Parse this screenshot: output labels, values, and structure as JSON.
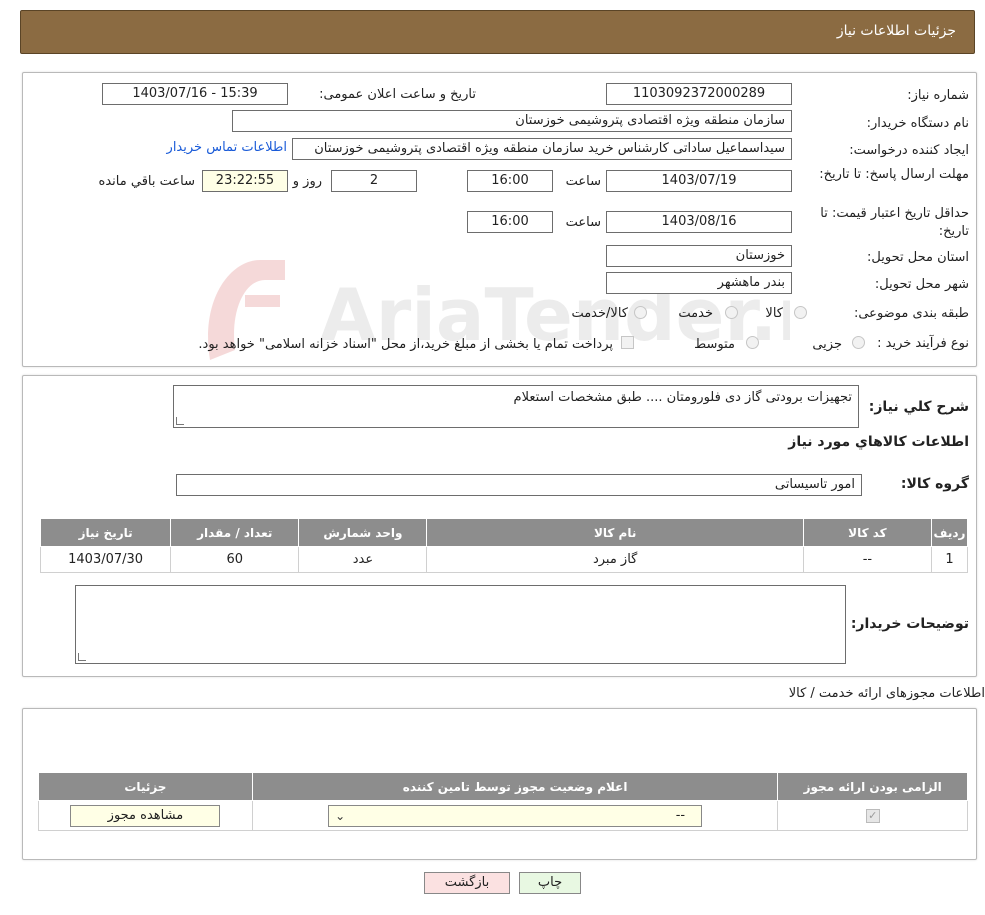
{
  "header": {
    "title": "جزئیات اطلاعات نیاز"
  },
  "watermark": {
    "text": "AriaTender.neT"
  },
  "details": {
    "need_number_label": "شماره نیاز:",
    "need_number": "1103092372000289",
    "announce_label": "تاریخ و ساعت اعلان عمومی:",
    "announce_value": "1403/07/16 - 15:39",
    "buyer_label": "نام دستگاه خریدار:",
    "buyer_value": "سازمان منطقه ویژه اقتصادی پتروشیمی خوزستان",
    "creator_label": "ایجاد کننده درخواست:",
    "creator_value": "سیداسماعیل ساداتی کارشناس خرید سازمان منطقه ویژه اقتصادی پتروشیمی خوزستان",
    "contact_link": "اطلاعات تماس خریدار",
    "deadline_label": "مهلت ارسال پاسخ: تا تاریخ:",
    "deadline_date": "1403/07/19",
    "time_label": "ساعت",
    "deadline_time": "16:00",
    "days_value": "2",
    "days_label": "روز و",
    "remaining_time": "23:22:55",
    "remaining_label": "ساعت باقي مانده",
    "validity_label": "حداقل تاریخ اعتبار قیمت: تا تاریخ:",
    "validity_date": "1403/08/16",
    "validity_time": "16:00",
    "province_label": "استان محل تحویل:",
    "province_value": "خوزستان",
    "city_label": "شهر محل تحویل:",
    "city_value": "بندر ماهشهر",
    "category_label": "طبقه بندی موضوعی:",
    "category_options": [
      "کالا",
      "خدمت",
      "کالا/خدمت"
    ],
    "process_label": "نوع فرآیند خرید :",
    "process_options": [
      "جزیی",
      "متوسط"
    ],
    "process_note": "پرداخت تمام یا بخشی از مبلغ خرید،از محل \"اسناد خزانه اسلامی\" خواهد بود."
  },
  "description": {
    "label": "شرح کلي نياز:",
    "value": "تجهیزات برودتی گاز دی فلورومتان .... طبق مشخصات استعلام",
    "goods_info_title": "اطلاعات کالاهاي مورد نياز",
    "group_label": "گروه کالا:",
    "group_value": "امور تاسیساتی"
  },
  "items_table": {
    "headers": [
      "ردیف",
      "کد کالا",
      "نام کالا",
      "واحد شمارش",
      "تعداد / مقدار",
      "تاریخ نیاز"
    ],
    "rows": [
      [
        "1",
        "--",
        "گاز مبرد",
        "عدد",
        "60",
        "1403/07/30"
      ]
    ]
  },
  "buyer_notes": {
    "label": "توضیحات خریدار:",
    "value": ""
  },
  "permits": {
    "title": "اطلاعات مجوزهای ارائه خدمت / کالا",
    "headers": [
      "الزامی بودن ارائه مجوز",
      "اعلام وضعیت مجوز توسط تامین کننده",
      "جزئیات"
    ],
    "select_value": "--",
    "view_button": "مشاهده مجوز"
  },
  "footer": {
    "print_button": "چاپ",
    "back_button": "بازگشت"
  },
  "colors": {
    "header_bg": "#8b6b42",
    "table_header_bg": "#8d8d8d",
    "print_bg": "#e8f8e2",
    "back_bg": "#fbe1e1",
    "link": "#1a5bd8"
  }
}
